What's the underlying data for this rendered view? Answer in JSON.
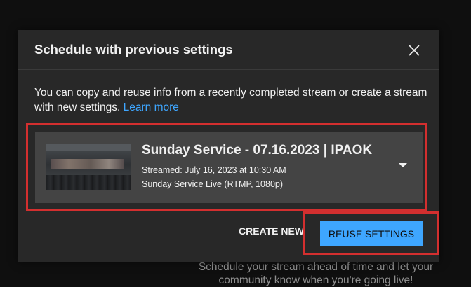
{
  "background": {
    "hint_text": "Schedule your stream ahead of time and let your community know when you're going live!"
  },
  "dialog": {
    "title": "Schedule with previous settings",
    "description": "You can copy and reuse info from a recently completed stream or create a stream with new settings.",
    "learn_more_label": "Learn more",
    "close_icon": "close-icon"
  },
  "stream": {
    "title": "Sunday Service - 07.16.2023 | IPAOK",
    "streamed": "Streamed: July 16, 2023 at 10:30 AM",
    "details": "Sunday Service Live (RTMP, 1080p)",
    "dropdown_icon": "chevron-down-icon"
  },
  "actions": {
    "create_new_label": "CREATE NEW",
    "reuse_label": "REUSE SETTINGS"
  },
  "colors": {
    "accent": "#3ea6ff",
    "highlight": "#d32f2f",
    "dialog_bg": "#282828",
    "card_bg": "#444444"
  }
}
